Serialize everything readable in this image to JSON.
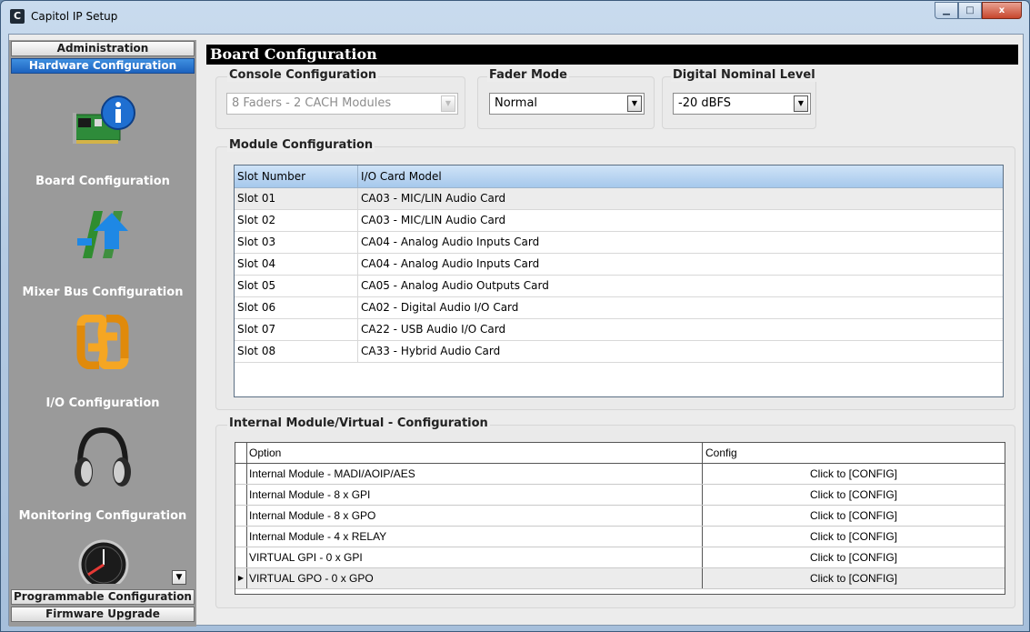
{
  "window": {
    "title": "Capitol IP Setup",
    "app_icon_letter": "C",
    "minimize_glyph": "▁",
    "maximize_glyph": "□",
    "close_glyph": "x"
  },
  "nav": {
    "top_buttons": [
      {
        "label": "Administration",
        "active": false
      },
      {
        "label": "Hardware Configuration",
        "active": true
      }
    ],
    "items": [
      {
        "label": "Board Configuration",
        "icon": "board-info-icon"
      },
      {
        "label": "Mixer Bus Configuration",
        "icon": "mixer-bus-arrows-icon"
      },
      {
        "label": "I/O Configuration",
        "icon": "io-loop-icon"
      },
      {
        "label": "Monitoring Configuration",
        "icon": "headphones-icon"
      },
      {
        "label": "",
        "icon": "clock-gauge-icon"
      }
    ],
    "scroll_glyph": "▼",
    "bottom_buttons": [
      {
        "label": "Programmable Configuration"
      },
      {
        "label": "Firmware Upgrade"
      }
    ]
  },
  "page": {
    "title": "Board Configuration"
  },
  "console_config": {
    "label": "Console Configuration",
    "value": "8 Faders - 2 CACH Modules",
    "disabled": true
  },
  "fader_mode": {
    "label": "Fader Mode",
    "value": "Normal"
  },
  "digital_level": {
    "label": "Digital Nominal Level",
    "value": "-20 dBFS"
  },
  "module_config": {
    "label": "Module Configuration",
    "columns": [
      "Slot Number",
      "I/O Card Model"
    ],
    "rows": [
      [
        "Slot 01",
        "CA03 - MIC/LIN Audio Card"
      ],
      [
        "Slot 02",
        "CA03 - MIC/LIN Audio Card"
      ],
      [
        "Slot 03",
        "CA04 - Analog Audio Inputs Card"
      ],
      [
        "Slot 04",
        "CA04 - Analog Audio Inputs Card"
      ],
      [
        "Slot 05",
        "CA05 - Analog Audio Outputs Card"
      ],
      [
        "Slot 06",
        "CA02 - Digital Audio I/O Card"
      ],
      [
        "Slot 07",
        "CA22 - USB Audio I/O Card"
      ],
      [
        "Slot 08",
        "CA33 - Hybrid Audio Card"
      ]
    ]
  },
  "internal_config": {
    "label": "Internal Module/Virtual - Configuration",
    "columns": [
      "Option",
      "Config"
    ],
    "row_pointer_glyph": "▶",
    "rows": [
      [
        "Internal Module - MADI/AOIP/AES",
        "Click to [CONFIG]"
      ],
      [
        "Internal Module - 8 x GPI",
        "Click to [CONFIG]"
      ],
      [
        "Internal Module - 8 x GPO",
        "Click to [CONFIG]"
      ],
      [
        "Internal Module - 4 x RELAY",
        "Click to [CONFIG]"
      ],
      [
        "VIRTUAL GPI - 0 x GPI",
        "Click to [CONFIG]"
      ],
      [
        "VIRTUAL GPO - 0 x GPO",
        "Click to [CONFIG]"
      ]
    ]
  }
}
